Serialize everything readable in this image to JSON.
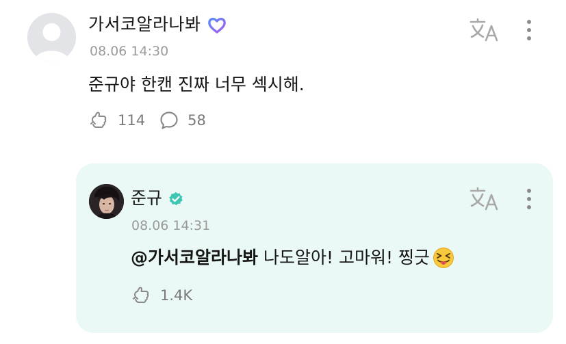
{
  "post": {
    "author": "가서코알라나봐",
    "timestamp": "08.06 14:30",
    "text": "준규야 한캔 진짜 너무 섹시해.",
    "reaction_count": "114",
    "comment_count": "58",
    "avatar_icon": "default-avatar-icon",
    "badge_icon": "heart-badge-icon",
    "badge_color": "#7c6cf0"
  },
  "reply": {
    "author": "준규",
    "timestamp": "08.06 14:31",
    "mention": "@가서코알라나봐",
    "text": "나도알아! 고마워! 찡긋",
    "emoji": "😝",
    "reaction_count": "1.4K",
    "badge_icon": "verified-check-icon",
    "badge_color": "#3cc7b4",
    "card_background": "#eaf9f6"
  },
  "icons": {
    "translate": "translate-icon",
    "more": "more-vertical-icon",
    "reaction": "reaction-icon",
    "comment": "comment-icon"
  }
}
